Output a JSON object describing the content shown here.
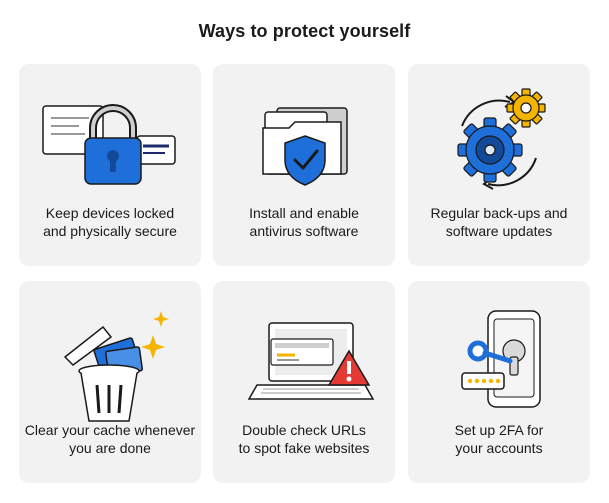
{
  "title": "Ways to protect yourself",
  "colors": {
    "card_bg": "#f2f2f2",
    "blue": "#1e6fd9",
    "yellow": "#f5b400",
    "red": "#e53935",
    "outline": "#1a1a1a"
  },
  "cards": [
    {
      "icon": "padlock-icon",
      "line1": "Keep devices locked",
      "line2": "and physically secure"
    },
    {
      "icon": "antivirus-shield-icon",
      "line1": "Install and enable",
      "line2": "antivirus software"
    },
    {
      "icon": "gears-update-icon",
      "line1": "Regular back-ups and",
      "line2": "software updates"
    },
    {
      "icon": "trash-cache-icon",
      "line1": "Clear your cache whenever",
      "line2": "you are done"
    },
    {
      "icon": "laptop-warning-icon",
      "line1": "Double check URLs",
      "line2": "to spot fake websites"
    },
    {
      "icon": "phone-2fa-key-icon",
      "line1": "Set up 2FA for",
      "line2": "your accounts"
    }
  ]
}
